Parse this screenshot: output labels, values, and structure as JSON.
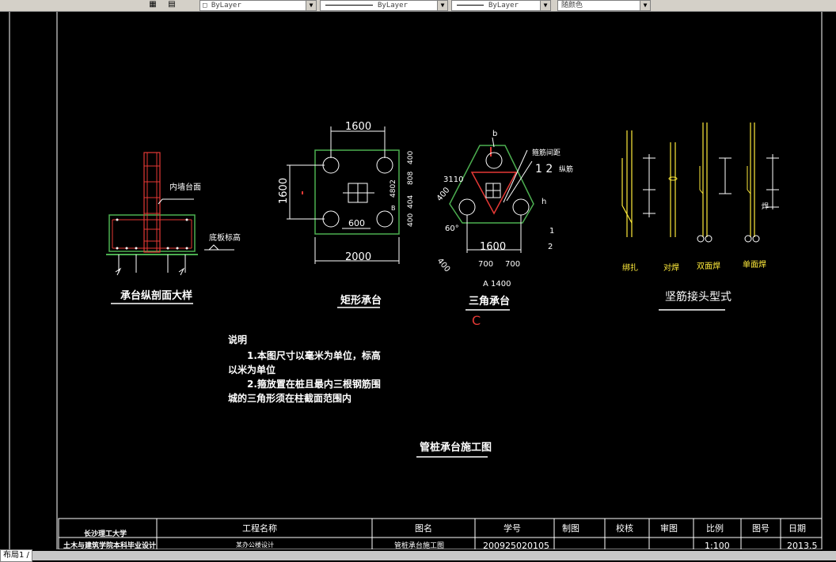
{
  "toolbar": {
    "layer_combo": "ByLayer",
    "linetype_combo": "ByLayer",
    "lineweight_combo": "ByLayer",
    "color_combo": "随颜色"
  },
  "drawing": {
    "detail1": {
      "title": "承台纵剖面大样",
      "label_top": "内墙台面",
      "label_bottom": "底板标高"
    },
    "detail2": {
      "title": "矩形承台",
      "dim_top": "1600",
      "dim_left": "1600",
      "dim_bottom": "2000",
      "dim_inner": "600",
      "dim_r1": "400",
      "dim_r2": "808",
      "dim_r3": "404",
      "dim_r4": "400",
      "dim_mid": "4802",
      "label_b": "B"
    },
    "detail3": {
      "title": "三角承台",
      "label_b": "b",
      "label_h": "h",
      "dim_3110": "3110",
      "dim_400a": "400",
      "dim_400b": "400",
      "angle": "60°",
      "dim_1600": "1600",
      "dim_700a": "700",
      "dim_700b": "700",
      "dim_A1400": "A  1400",
      "num1": "1",
      "num2": "2",
      "numbers_12": "1 2",
      "label_note": "箍筋间距",
      "label_side": "纵筋",
      "red_c": "C"
    },
    "detail4": {
      "title": "坚筋接头型式",
      "labels": [
        "绑扎",
        "对焊",
        "双面焊",
        "单面焊"
      ],
      "side_label": "焊"
    },
    "notes": {
      "heading": "说明",
      "line1": "1.本图尺寸以毫米为单位，标高",
      "line2": "以米为单位",
      "line3": "2.箍放置在桩且最内三根钢筋围",
      "line4": "城的三角形须在柱截面范围内"
    },
    "main_title": "管桩承台施工图"
  },
  "title_block": {
    "school1": "长沙理工大学",
    "school2": "土木与建筑学院本科毕业设计",
    "project_name_label": "工程名称",
    "project_name_value": "某办公楼设计",
    "drawing_name_label": "图名",
    "drawing_name_value": "管桩承台施工图",
    "student_id_label": "学号",
    "student_id_value": "200925020105",
    "drawn_label": "制图",
    "check_label": "校核",
    "review_label": "审图",
    "scale_label": "比例",
    "scale_value": "1:100",
    "sheet_label": "图号",
    "date_label": "日期",
    "date_value": "2013.5"
  },
  "status": {
    "layout_tab": "布局1 /"
  }
}
